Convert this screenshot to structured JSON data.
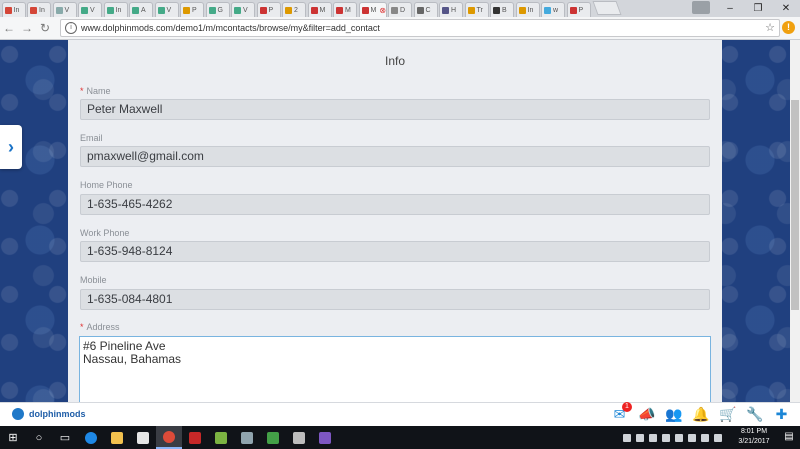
{
  "browser": {
    "tabs": [
      {
        "label": "In",
        "icon": "gmail-icon",
        "color": "#d44638"
      },
      {
        "label": "In",
        "icon": "gmail-icon",
        "color": "#d44638"
      },
      {
        "label": "V",
        "icon": "page-icon",
        "color": "#8aa"
      },
      {
        "label": "V",
        "icon": "loop-icon",
        "color": "#4a8"
      },
      {
        "label": "In",
        "icon": "loop-icon",
        "color": "#4a8"
      },
      {
        "label": "A",
        "icon": "loop-icon",
        "color": "#4a8"
      },
      {
        "label": "V",
        "icon": "loop-icon",
        "color": "#4a8"
      },
      {
        "label": "P",
        "icon": "page-icon",
        "color": "#d90"
      },
      {
        "label": "G",
        "icon": "page-icon",
        "color": "#4a8"
      },
      {
        "label": "V",
        "icon": "loop-icon",
        "color": "#4a8"
      },
      {
        "label": "P",
        "icon": "page-icon",
        "color": "#c33"
      },
      {
        "label": "2",
        "icon": "page-icon",
        "color": "#d90"
      },
      {
        "label": "M",
        "icon": "page-icon",
        "color": "#c33"
      },
      {
        "label": "M",
        "icon": "page-icon",
        "color": "#c33"
      },
      {
        "label": "M",
        "icon": "page-icon",
        "color": "#c33",
        "active": true
      },
      {
        "label": "D",
        "icon": "document-icon",
        "color": "#888"
      },
      {
        "label": "C",
        "icon": "face-icon",
        "color": "#666"
      },
      {
        "label": "H",
        "icon": "page-icon",
        "color": "#558"
      },
      {
        "label": "Tr",
        "icon": "page-icon",
        "color": "#d90"
      },
      {
        "label": "B",
        "icon": "page-icon",
        "color": "#333"
      },
      {
        "label": "In",
        "icon": "page-icon",
        "color": "#d90"
      },
      {
        "label": "w",
        "icon": "page-icon",
        "color": "#4ad"
      },
      {
        "label": "P",
        "icon": "page-icon",
        "color": "#c33"
      }
    ],
    "url": "www.dolphinmods.com/demo1/m/mcontacts/browse/my&filter=add_contact"
  },
  "form": {
    "title": "Info",
    "name_label": "Name",
    "name_value": "Peter Maxwell",
    "email_label": "Email",
    "email_value": "pmaxwell@gmail.com",
    "home_phone_label": "Home Phone",
    "home_phone_value": "1-635-465-4262",
    "work_phone_label": "Work Phone",
    "work_phone_value": "1-635-948-8124",
    "mobile_label": "Mobile",
    "mobile_value": "1-635-084-4801",
    "address_label": "Address",
    "address_line1": "#6 Pineline Ave",
    "address_line2": "Nassau, Bahamas"
  },
  "appbar": {
    "brand": "dolphinmods",
    "mail_badge": "1"
  },
  "taskbar": {
    "time": "8:01 PM",
    "date": "3/21/2017"
  },
  "colors": {
    "accent": "#1c86d6",
    "badge": "#e22222",
    "required": "#e03030"
  }
}
